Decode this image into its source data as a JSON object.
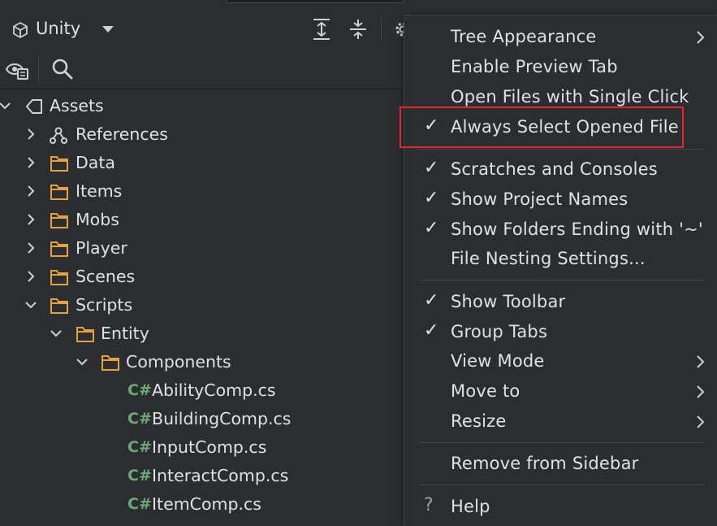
{
  "header": {
    "project_name": "Unity",
    "icons": [
      "unity-logo-icon",
      "chevron-down-icon",
      "expand-all-icon",
      "collapse-all-icon",
      "gear-icon"
    ]
  },
  "toolbar": {
    "icons": [
      "scope-filter-icon",
      "search-icon"
    ]
  },
  "tree": {
    "root": "Assets",
    "items": [
      {
        "label": "References"
      },
      {
        "label": "Data"
      },
      {
        "label": "Items"
      },
      {
        "label": "Mobs"
      },
      {
        "label": "Player"
      },
      {
        "label": "Scenes"
      },
      {
        "label": "Scripts"
      },
      {
        "label": "Entity"
      },
      {
        "label": "Components"
      }
    ],
    "file_badge": "C#",
    "files": [
      {
        "label": "AbilityComp.cs"
      },
      {
        "label": "BuildingComp.cs"
      },
      {
        "label": "InputComp.cs"
      },
      {
        "label": "InteractComp.cs"
      },
      {
        "label": "ItemComp.cs"
      }
    ]
  },
  "menu": {
    "items": [
      {
        "label": "Tree Appearance",
        "checked": false,
        "submenu": true
      },
      {
        "label": "Enable Preview Tab",
        "checked": false,
        "submenu": false
      },
      {
        "label": "Open Files with Single Click",
        "checked": false,
        "submenu": false
      },
      {
        "label": "Always Select Opened File",
        "checked": true,
        "submenu": false,
        "highlighted": true
      },
      {
        "label": "Scratches and Consoles",
        "checked": true,
        "submenu": false
      },
      {
        "label": "Show Project Names",
        "checked": true,
        "submenu": false
      },
      {
        "label": "Show Folders Ending with '~'",
        "checked": true,
        "submenu": false
      },
      {
        "label": "File Nesting Settings...",
        "checked": false,
        "submenu": false
      },
      {
        "label": "Show Toolbar",
        "checked": true,
        "submenu": false
      },
      {
        "label": "Group Tabs",
        "checked": true,
        "submenu": false
      },
      {
        "label": "View Mode",
        "checked": false,
        "submenu": true
      },
      {
        "label": "Move to",
        "checked": false,
        "submenu": true
      },
      {
        "label": "Resize",
        "checked": false,
        "submenu": true
      },
      {
        "label": "Remove from Sidebar",
        "checked": false,
        "submenu": false
      },
      {
        "label": "Help",
        "checked": false,
        "submenu": false,
        "icon": "help-icon"
      }
    ],
    "check_glyph": "✓",
    "help_glyph": "?",
    "highlight_color": "#e0272d"
  }
}
